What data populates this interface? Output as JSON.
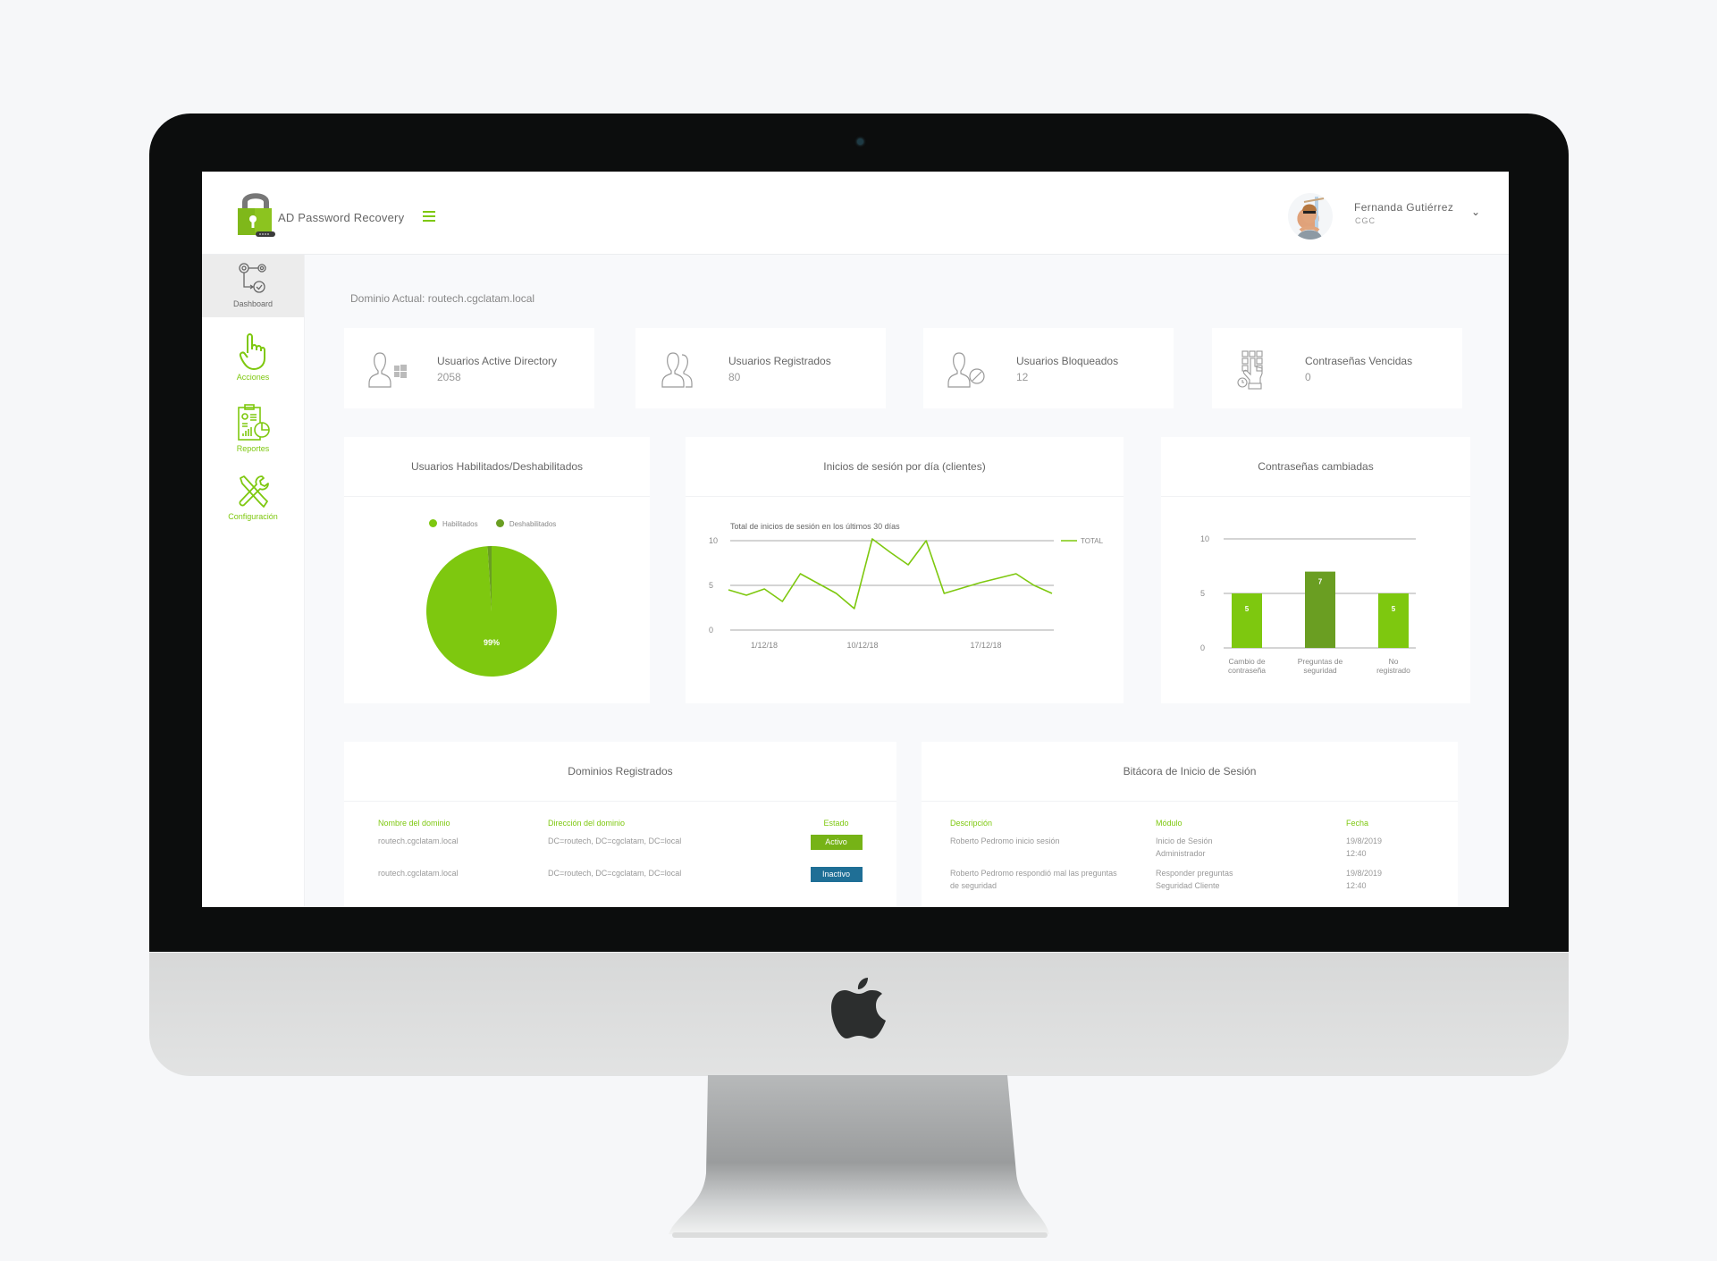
{
  "header": {
    "app_title": "AD Password Recovery",
    "menu_icon": "hamburger-icon",
    "user": {
      "name": "Fernanda Gutiérrez",
      "org": "CGC",
      "dropdown_icon": "chevron-down-icon"
    }
  },
  "sidebar": {
    "items": [
      {
        "label": "Dashboard",
        "icon": "workflow-gears-icon",
        "active": true
      },
      {
        "label": "Acciones",
        "icon": "hand-pointer-icon"
      },
      {
        "label": "Reportes",
        "icon": "report-clipboard-icon"
      },
      {
        "label": "Configuración",
        "icon": "tools-icon"
      }
    ]
  },
  "main": {
    "current_domain": "Dominio Actual: routech.cgclatam.local",
    "stats": [
      {
        "title": "Usuarios Active Directory",
        "value": "2058",
        "icon": "user-windows-icon"
      },
      {
        "title": "Usuarios Registrados",
        "value": "80",
        "icon": "users-icon"
      },
      {
        "title": "Usuarios Bloqueados",
        "value": "12",
        "icon": "user-blocked-icon"
      },
      {
        "title": "Contraseñas Vencidas",
        "value": "0",
        "icon": "keypad-expired-icon"
      }
    ],
    "domains_panel": {
      "title": "Dominios Registrados",
      "columns": [
        "Nombre del dominio",
        "Dirección del dominio",
        "Estado"
      ],
      "rows": [
        {
          "name": "routech.cgclatam.local",
          "address": "DC=routech, DC=cgclatam, DC=local",
          "status": "Activo"
        },
        {
          "name": "routech.cgclatam.local",
          "address": "DC=routech, DC=cgclatam, DC=local",
          "status": "Inactivo"
        }
      ]
    },
    "log_panel": {
      "title": "Bitácora de Inicio de Sesión",
      "columns": [
        "Descripción",
        "Módulo",
        "Fecha"
      ],
      "rows": [
        {
          "description": "Roberto Pedromo inicio sesión",
          "module_line1": "Inicio de Sesión",
          "module_line2": "Administrador",
          "date": "19/8/2019",
          "time": "12:40"
        },
        {
          "description": "Roberto Pedromo respondió mal las preguntas de seguridad",
          "module_line1": "Responder preguntas",
          "module_line2": "Seguridad Cliente",
          "date": "19/8/2019",
          "time": "12:40"
        }
      ]
    }
  },
  "colors": {
    "accent": "#7ec80f",
    "accent_dark": "#6a9e22",
    "inactive": "#1f6f96"
  },
  "chart_data": [
    {
      "type": "pie",
      "title": "Usuarios Habilitados/Deshabilitados",
      "legend": [
        "Habilitados",
        "Deshabilitados"
      ],
      "legend_position": "top",
      "values": [
        99,
        1
      ],
      "colors": [
        "#7ec80f",
        "#6a9e22"
      ],
      "data_labels": [
        "99%"
      ]
    },
    {
      "type": "line",
      "title": "Inicios de sesión por día (clientes)",
      "subtitle": "Total de inicios de sesión en los últimos 30 días",
      "legend": [
        "TOTAL"
      ],
      "legend_position": "top-right",
      "x_tick_labels": [
        "1/12/18",
        "10/12/18",
        "17/12/18"
      ],
      "y_ticks": [
        0,
        5,
        10
      ],
      "ylim": [
        0,
        10
      ],
      "grid": true,
      "series": [
        {
          "name": "TOTAL",
          "color": "#7ec80f",
          "values": [
            4.5,
            3.9,
            4.6,
            3.2,
            6.3,
            5.2,
            4.1,
            2.4,
            10.2,
            8.7,
            7.3,
            10.0,
            4.1,
            4.7,
            5.3,
            5.8,
            6.3,
            5.0,
            4.1
          ]
        }
      ]
    },
    {
      "type": "bar",
      "title": "Contraseñas cambiadas",
      "categories": [
        "Cambio de contraseña",
        "Preguntas de seguridad",
        "No registrado"
      ],
      "values": [
        5,
        7,
        5
      ],
      "colors": [
        "#7ec80f",
        "#6a9e22",
        "#7ec80f"
      ],
      "y_ticks": [
        0,
        5,
        10
      ],
      "ylim": [
        0,
        10
      ],
      "grid": true
    }
  ]
}
